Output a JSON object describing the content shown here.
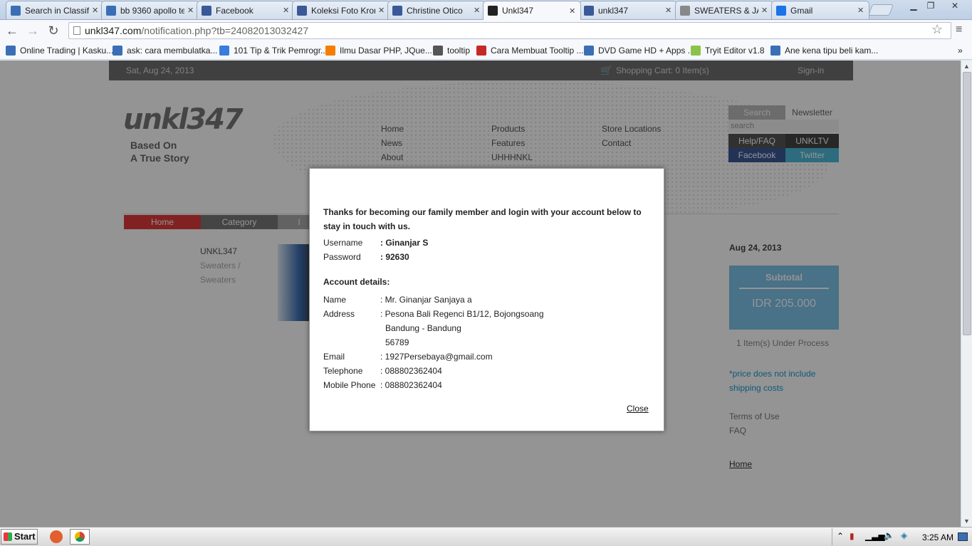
{
  "browser": {
    "tabs": [
      {
        "label": "Search in Classifi",
        "icon": "kaskus-icon",
        "color": "#3a6fb5"
      },
      {
        "label": "bb 9360 apollo te",
        "icon": "kaskus-icon",
        "color": "#3a6fb5"
      },
      {
        "label": "Facebook",
        "icon": "facebook-icon",
        "color": "#3b5998"
      },
      {
        "label": "Koleksi Foto Kron",
        "icon": "facebook-icon",
        "color": "#3b5998"
      },
      {
        "label": "Christine Otico",
        "icon": "facebook-icon",
        "color": "#3b5998"
      },
      {
        "label": "Unkl347",
        "icon": "unkl-icon",
        "color": "#222222",
        "active": true
      },
      {
        "label": "unkl347",
        "icon": "facebook-icon",
        "color": "#3b5998"
      },
      {
        "label": "SWEATERS & JA",
        "icon": "smiley-icon",
        "color": "#888888"
      },
      {
        "label": "Gmail",
        "icon": "gmail-icon",
        "color": "#1a73e8"
      }
    ],
    "url_host": "unkl347.com",
    "url_path": "/notification.php?tb=24082013032427",
    "bookmarks": [
      {
        "label": "Online Trading | Kasku...",
        "color": "#3a6fb5"
      },
      {
        "label": "ask: cara membulatka...",
        "color": "#3a6fb5"
      },
      {
        "label": "101 Tip & Trik Pemrogr...",
        "color": "#3b7be0"
      },
      {
        "label": "Ilmu Dasar PHP, JQue...",
        "color": "#f57d00"
      },
      {
        "label": "tooltip",
        "color": "#555555"
      },
      {
        "label": "Cara Membuat Tooltip ...",
        "color": "#c62828"
      },
      {
        "label": "DVD Game HD + Apps ...",
        "color": "#3a6fb5"
      },
      {
        "label": "Tryit Editor v1.8",
        "color": "#8bc34a"
      },
      {
        "label": "Ane kena tipu beli kam...",
        "color": "#3a6fb5"
      }
    ],
    "bookmark_overflow": "»"
  },
  "site": {
    "date": "Sat, Aug 24, 2013",
    "cart": "Shopping Cart: 0 Item(s)",
    "signin": "Sign-in",
    "logo": "unkl347",
    "slogan_1": "Based On",
    "slogan_2": "A True Story",
    "nav_col1": [
      "Home",
      "News",
      "About"
    ],
    "nav_col2": [
      "Products",
      "Features",
      "UHHHNKL"
    ],
    "nav_col3": [
      "Store Locations",
      "Contact"
    ],
    "search_btn": "Search",
    "newsletter": "Newsletter",
    "search_placeholder": "search",
    "help": "Help/FAQ",
    "unkltv": "UNKLTV",
    "facebook": "Facebook",
    "twitter": "Twitter",
    "crumb_home": "Home",
    "crumb_category": "Category",
    "crumb_more": "I",
    "product_brand": "UNKL347",
    "product_cat": "Sweaters /",
    "product_sub": "Sweaters",
    "side_date": "Aug 24, 2013",
    "subtotal_label": "Subtotal",
    "subtotal_value": "IDR 205.000",
    "process": "1 Item(s) Under Process",
    "price_note_1": "*price does not include",
    "price_note_2": "shipping costs",
    "terms": "Terms of Use",
    "faq": "FAQ",
    "home_link": "Home"
  },
  "modal": {
    "intro": "Thanks for becoming our family member and login with your account below to stay in touch with us.",
    "username_label": "Username",
    "username_value": ": Ginanjar S",
    "password_label": "Password",
    "password_value": ": 92630",
    "account_heading": "Account details:",
    "name_label": "Name",
    "name_value": ": Mr. Ginanjar Sanjaya a",
    "address_label": "Address",
    "address_line1": ": Pesona Bali Regenci B1/12, Bojongsoang",
    "address_line2": "Bandung - Bandung",
    "address_line3": "56789",
    "email_label": "Email",
    "email_value": ": 1927Persebaya@gmail.com",
    "telephone_label": "Telephone",
    "telephone_value": ": 088802362404",
    "mobile_label": "Mobile Phone",
    "mobile_value": ": 088802362404",
    "close_label": "Close"
  },
  "taskbar": {
    "start": "Start",
    "time": "3:25 AM"
  }
}
